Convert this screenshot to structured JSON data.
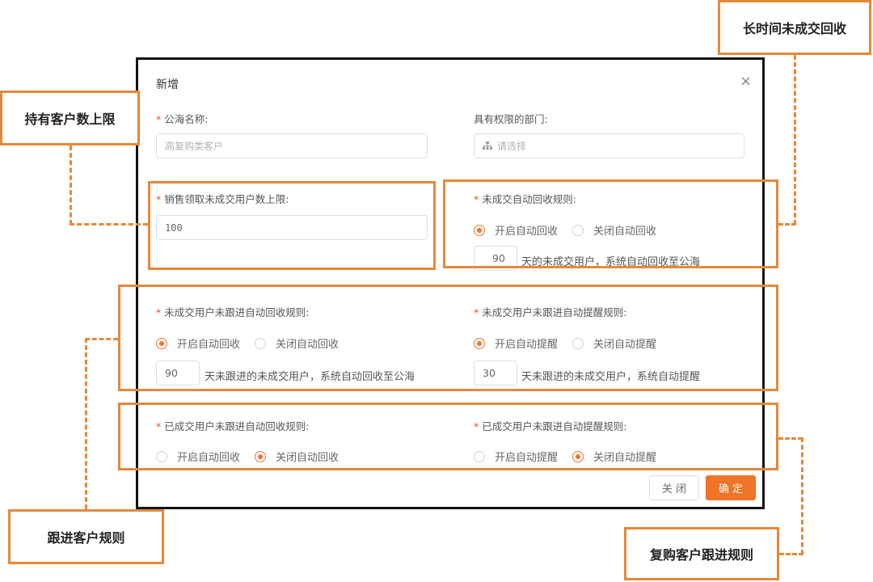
{
  "dialog": {
    "title": "新增",
    "close_icon": "×",
    "pool_name": {
      "label": "公海名称:",
      "placeholder": "高复购类客户"
    },
    "departments": {
      "label": "具有权限的部门:",
      "placeholder": "请选择"
    },
    "claim_limit": {
      "label": "销售领取未成交用户数上限:",
      "value": "100"
    },
    "unclosed_auto_recycle": {
      "label": "未成交自动回收规则:",
      "on_label": "开启自动回收",
      "off_label": "关闭自动回收",
      "days": "90",
      "suffix": "天的未成交用户，系统自动回收至公海"
    },
    "unfollowed_recycle": {
      "label": "未成交用户未跟进自动回收规则:",
      "on_label": "开启自动回收",
      "off_label": "关闭自动回收",
      "days": "90",
      "suffix": "天未跟进的未成交用户，系统自动回收至公海"
    },
    "unfollowed_remind": {
      "label": "未成交用户未跟进自动提醒规则:",
      "on_label": "开启自动提醒",
      "off_label": "关闭自动提醒",
      "days": "30",
      "suffix": "天未跟进的未成交用户，系统自动提醒"
    },
    "closed_recycle": {
      "label": "已成交用户未跟进自动回收规则:",
      "on_label": "开启自动回收",
      "off_label": "关闭自动回收"
    },
    "closed_remind": {
      "label": "已成交用户未跟进自动提醒规则:",
      "on_label": "开启自动提醒",
      "off_label": "关闭自动提醒"
    },
    "buttons": {
      "close": "关 闭",
      "confirm": "确 定"
    }
  },
  "annotations": {
    "holding_limit": "持有客户数上限",
    "long_time_recycle": "长时间未成交回收",
    "follow_rules": "跟进客户规则",
    "repurchase_rules": "复购客户跟进规则"
  },
  "colors": {
    "accent": "#f07428",
    "annotation": "#e6883a"
  }
}
